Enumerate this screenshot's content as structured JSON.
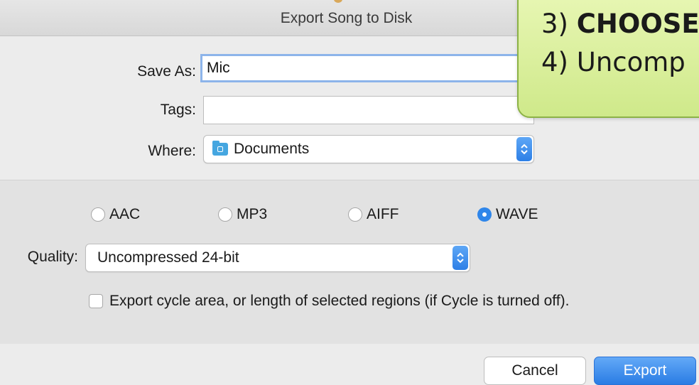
{
  "dialog": {
    "title": "Export Song to Disk",
    "save_as_label": "Save As:",
    "save_as_value": "Mic",
    "tags_label": "Tags:",
    "tags_value": "",
    "where_label": "Where:",
    "where_value": "Documents",
    "where_icon": "folder-icon"
  },
  "format": {
    "options": [
      {
        "label": "AAC",
        "selected": false
      },
      {
        "label": "MP3",
        "selected": false
      },
      {
        "label": "AIFF",
        "selected": false
      },
      {
        "label": "WAVE",
        "selected": true
      }
    ],
    "quality_label": "Quality:",
    "quality_value": "Uncompressed 24-bit",
    "cycle_checkbox_label": "Export cycle area, or length of selected regions (if Cycle is turned off).",
    "cycle_checked": false
  },
  "buttons": {
    "cancel": "Cancel",
    "export": "Export"
  },
  "callout": {
    "line3_prefix": "3) ",
    "line3_bold": "CHOOSE",
    "line4": "4) Uncomp"
  },
  "colors": {
    "accent": "#2f86ea",
    "callout_fill": "#d9f09a",
    "callout_border": "#8cb246"
  }
}
